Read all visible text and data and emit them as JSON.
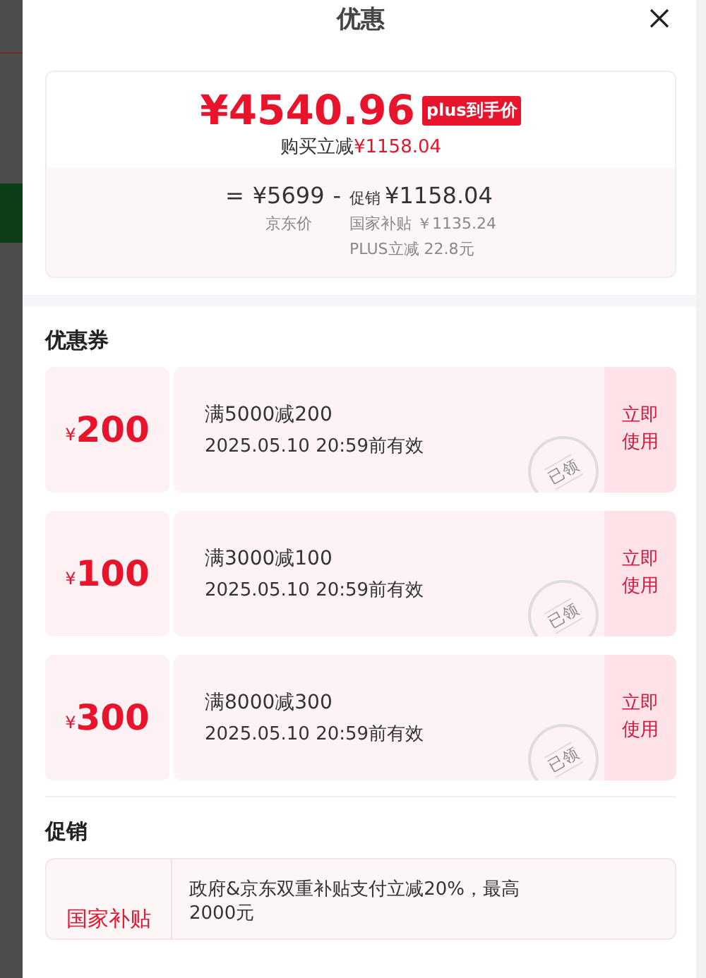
{
  "dialog": {
    "title": "优惠"
  },
  "summary": {
    "price": "¥4540.96",
    "badge": "plus到手价",
    "saving_label": "购买立减",
    "saving_amount": "¥1158.04",
    "equals": "=",
    "base_price": "¥5699",
    "minus": "-",
    "promo_label": "促销",
    "promo_amount": "¥1158.04",
    "base_caption": "京东价",
    "breakdown": [
      "国家补贴 ￥1135.24",
      "PLUS立减 22.8元"
    ]
  },
  "coupons_title": "优惠券",
  "coupons": [
    {
      "currency": "¥",
      "amount": "200",
      "condition": "满5000减200",
      "validity": "2025.05.10 20:59前有效",
      "stamp": "已领",
      "action": "立即使用"
    },
    {
      "currency": "¥",
      "amount": "100",
      "condition": "满3000减100",
      "validity": "2025.05.10 20:59前有效",
      "stamp": "已领",
      "action": "立即使用"
    },
    {
      "currency": "¥",
      "amount": "300",
      "condition": "满8000减300",
      "validity": "2025.05.10 20:59前有效",
      "stamp": "已领",
      "action": "立即使用"
    }
  ],
  "promotions_title": "促销",
  "promotions": [
    {
      "tag": "国家补贴",
      "text": "政府&京东双重补贴支付立减20%，最高2000元"
    }
  ]
}
